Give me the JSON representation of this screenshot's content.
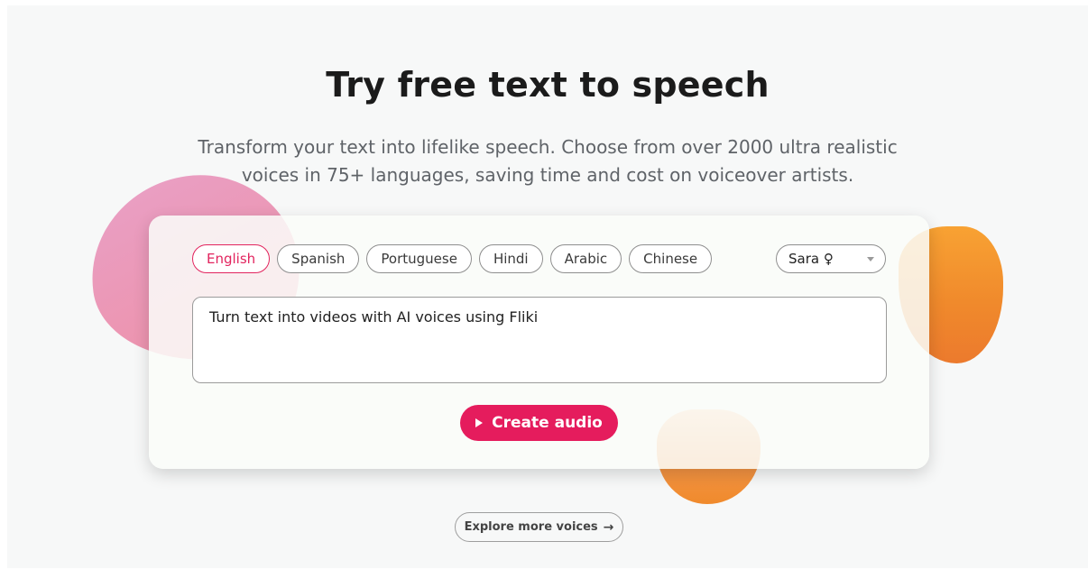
{
  "hero": {
    "title": "Try free text to speech",
    "subtitle": "Transform your text into lifelike speech. Choose from over 2000 ultra realistic voices in 75+ languages, saving time and cost on voiceover artists."
  },
  "languages": [
    {
      "label": "English",
      "active": true
    },
    {
      "label": "Spanish",
      "active": false
    },
    {
      "label": "Portuguese",
      "active": false
    },
    {
      "label": "Hindi",
      "active": false
    },
    {
      "label": "Arabic",
      "active": false
    },
    {
      "label": "Chinese",
      "active": false
    }
  ],
  "voice_select": {
    "selected": "Sara ♀",
    "caret_icon": "chevron-down-icon"
  },
  "text_input": {
    "value": "Turn text into videos with AI voices using Fliki"
  },
  "create_button": {
    "label": "Create audio",
    "icon": "play-icon"
  },
  "explore_button": {
    "label": "Explore more voices",
    "icon": "→"
  },
  "colors": {
    "accent": "#e51c5d",
    "blob_pink": "#ee95b5",
    "blob_orange": "#f59532",
    "background": "#f7f8f8"
  }
}
